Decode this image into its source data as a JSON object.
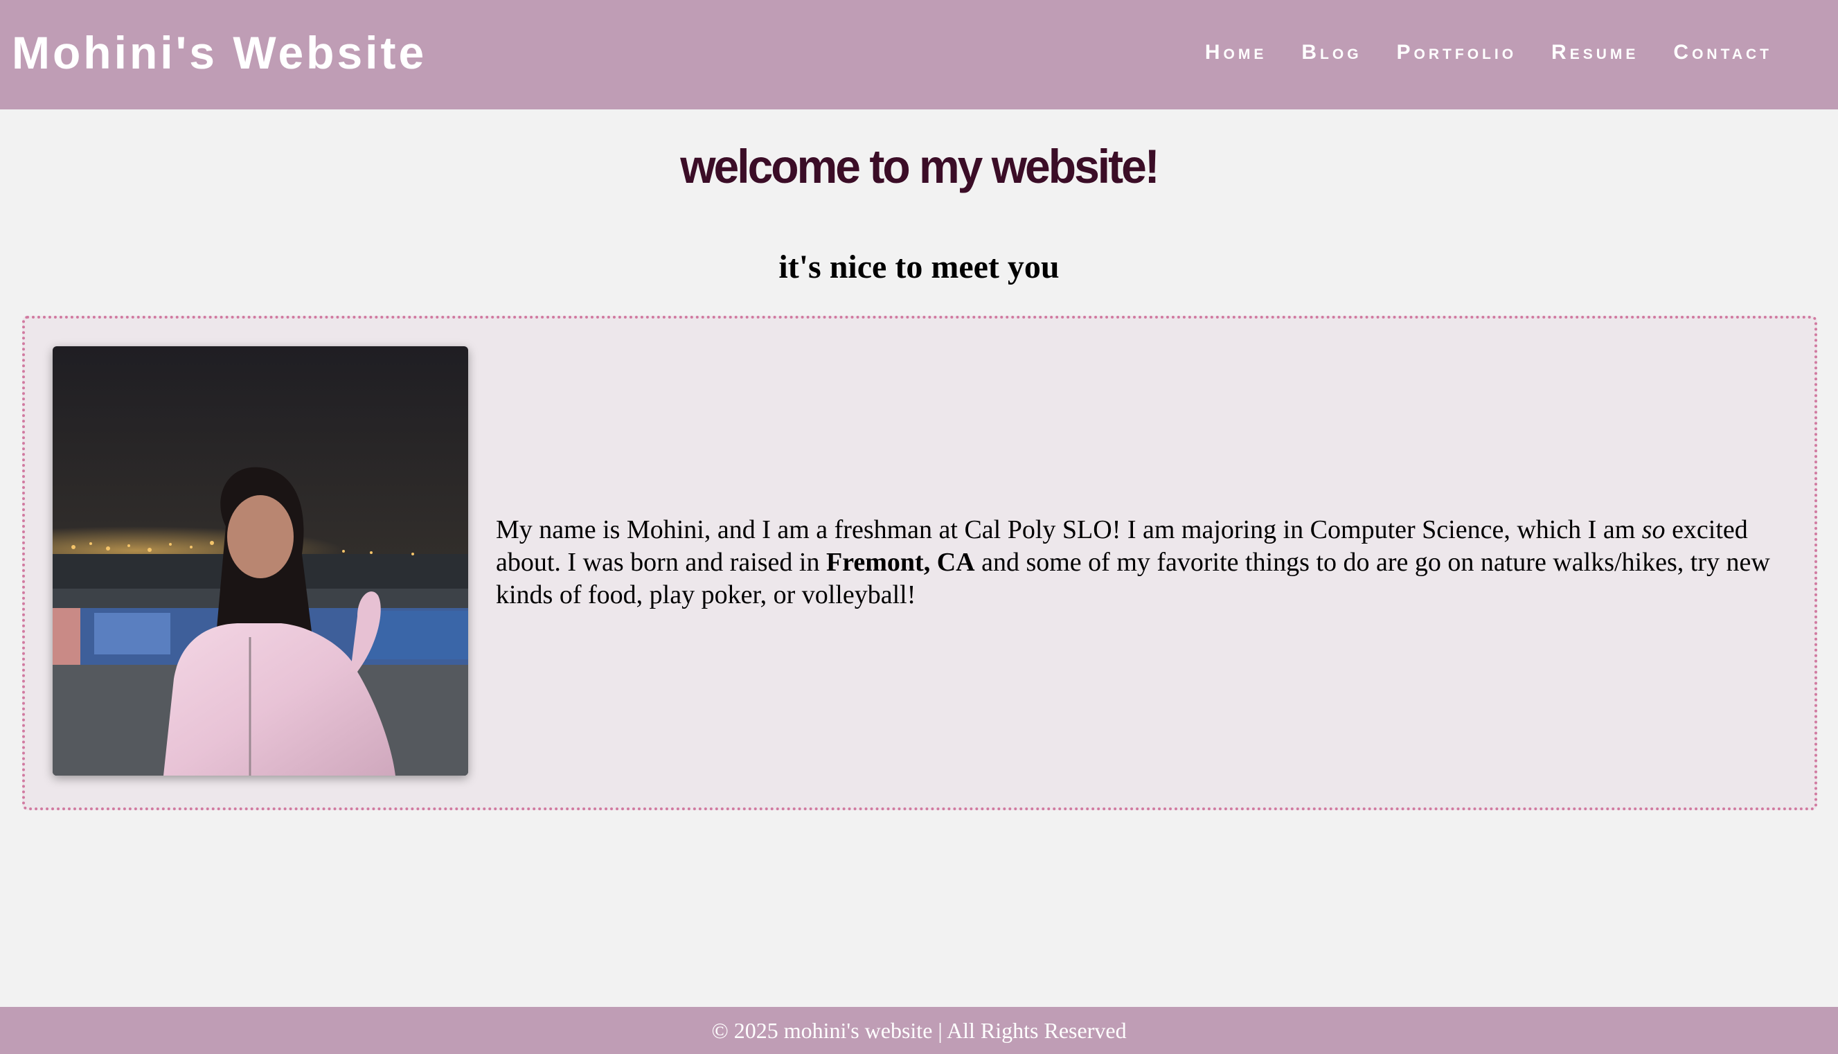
{
  "header": {
    "site_title": "Mohini's Website",
    "nav": [
      "Home",
      "Blog",
      "Portfolio",
      "Resume",
      "Contact"
    ]
  },
  "main": {
    "welcome": "welcome to my website!",
    "subtitle": "it's nice to meet you",
    "bio": {
      "part1": "My name is Mohini, and I am a freshman at Cal Poly SLO! I am majoring in Computer Science, which I am ",
      "emphasis": "so",
      "part2": " excited about. I was born and raised in ",
      "strong": "Fremont, CA",
      "part3": " and some of my favorite things to do are go on nature walks/hikes, try new kinds of food, play poker, or volleyball!"
    }
  },
  "footer": {
    "text": "© 2025 mohini's website | All Rights Reserved"
  },
  "colors": {
    "header_bg": "#bf9db5",
    "page_bg": "#f2f2f2",
    "card_bg": "#ede7eb",
    "card_border": "#d17aa0",
    "welcome_text": "#3b0d27"
  }
}
